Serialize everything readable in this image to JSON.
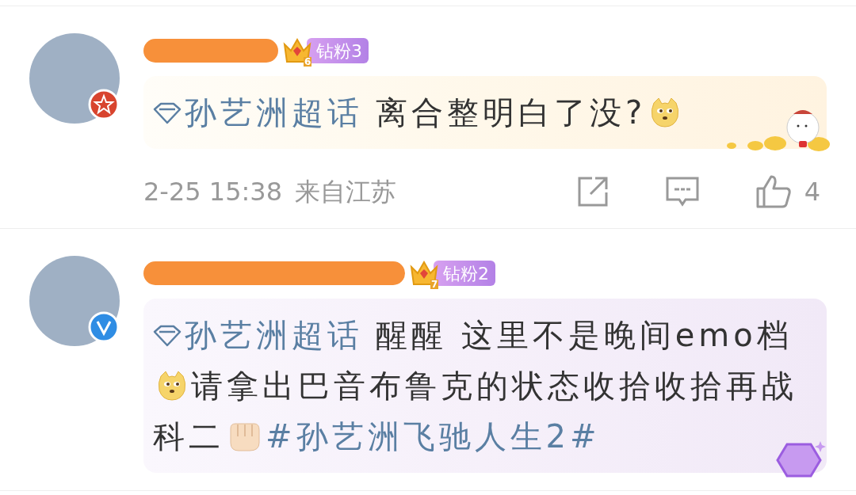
{
  "comments": [
    {
      "avatar_badge": {
        "kind": "star"
      },
      "crown_level": "6",
      "badge": "钻粉3",
      "bubble": {
        "kind": "gold"
      },
      "content": [
        {
          "kind": "topic",
          "text": "孙艺洲超话"
        },
        {
          "kind": "text",
          "text": "离合整明白了没?"
        },
        {
          "kind": "doge"
        }
      ],
      "footer": {
        "time": "2-25 15:38",
        "location": "来自江苏",
        "like_count": "4"
      }
    },
    {
      "avatar_badge": {
        "kind": "verified"
      },
      "crown_level": "7",
      "badge": "钻粉2",
      "bubble": {
        "kind": "purple"
      },
      "content": [
        {
          "kind": "topic",
          "text": "孙艺洲超话"
        },
        {
          "kind": "text",
          "text": "醒醒 这里不是晚间emo档"
        },
        {
          "kind": "doge"
        },
        {
          "kind": "text",
          "text": "请拿出巴音布鲁克的状态收拾收拾再战"
        },
        {
          "kind": "text",
          "text": "科二"
        },
        {
          "kind": "fist"
        },
        {
          "kind": "hashtag",
          "text": "#孙艺洲飞驰人生2#"
        }
      ]
    }
  ]
}
